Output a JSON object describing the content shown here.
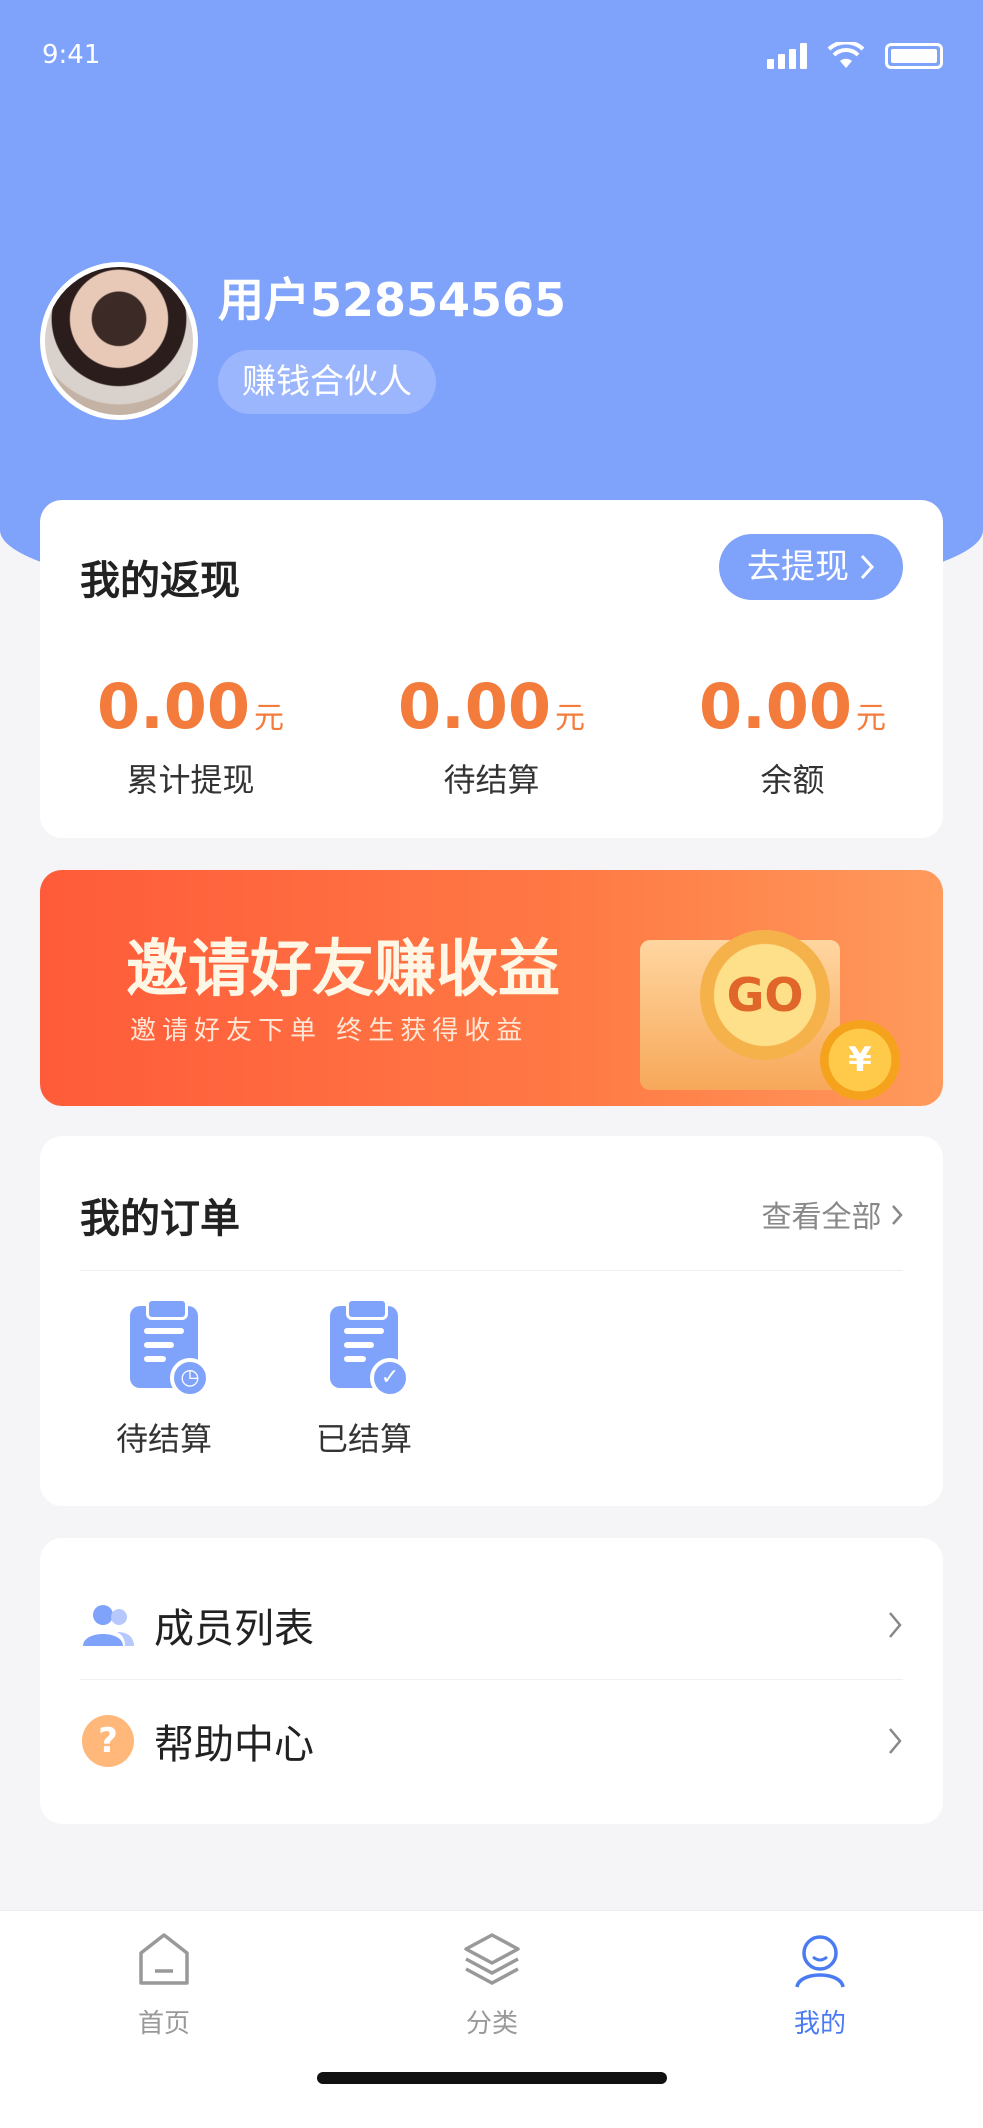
{
  "status_bar": {
    "time": "9:41"
  },
  "profile": {
    "username": "用户52854565",
    "role": "赚钱合伙人"
  },
  "cashback": {
    "title": "我的返现",
    "withdraw_label": "去提现",
    "stats": [
      {
        "value": "0.00",
        "unit": "元",
        "label": "累计提现"
      },
      {
        "value": "0.00",
        "unit": "元",
        "label": "待结算"
      },
      {
        "value": "0.00",
        "unit": "元",
        "label": "余额"
      }
    ]
  },
  "banner": {
    "title": "邀请好友赚收益",
    "subtitle": "邀请好友下单 终生获得收益",
    "badge": "GO",
    "coin": "¥"
  },
  "orders": {
    "title": "我的订单",
    "view_all": "查看全部",
    "items": [
      {
        "label": "待结算",
        "icon": "clock-clipboard-icon"
      },
      {
        "label": "已结算",
        "icon": "check-clipboard-icon"
      }
    ]
  },
  "menu": {
    "items": [
      {
        "label": "成员列表",
        "icon": "members-icon"
      },
      {
        "label": "帮助中心",
        "icon": "help-icon",
        "glyph": "?"
      }
    ]
  },
  "tabbar": {
    "items": [
      {
        "label": "首页",
        "icon": "home-icon"
      },
      {
        "label": "分类",
        "icon": "layers-icon"
      },
      {
        "label": "我的",
        "icon": "user-icon",
        "active": true
      }
    ]
  },
  "colors": {
    "primary": "#7fa2fb",
    "accent": "#f37b3c",
    "active_tab": "#4b7bf2"
  }
}
